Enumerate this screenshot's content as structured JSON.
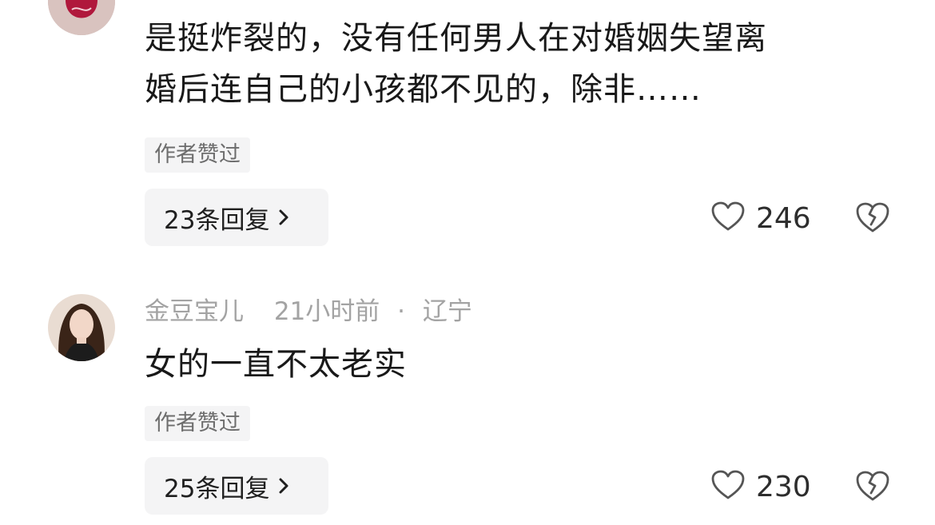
{
  "comments": [
    {
      "text_lines": [
        "是挺炸裂的，没有任何男人在对婚姻失望离",
        "婚后连自己的小孩都不见的，除非……"
      ],
      "author_badge": "作者赞过",
      "reply_label": "23条回复",
      "like_count": "246",
      "avatar_icon": "avatar-red-abstract"
    },
    {
      "username": "金豆宝儿",
      "time": "21小时前",
      "separator": "·",
      "location": "辽宁",
      "text": "女的一直不太老实",
      "author_badge": "作者赞过",
      "reply_label": "25条回复",
      "like_count": "230",
      "avatar_icon": "avatar-woman-portrait"
    }
  ],
  "icons": {
    "like": "heart-outline-icon",
    "dislike": "broken-heart-icon",
    "chevron": "chevron-right-icon"
  },
  "colors": {
    "text": "#191919",
    "meta": "#a3a3a3",
    "badge_bg": "#f4f4f5",
    "icon": "#555555"
  }
}
